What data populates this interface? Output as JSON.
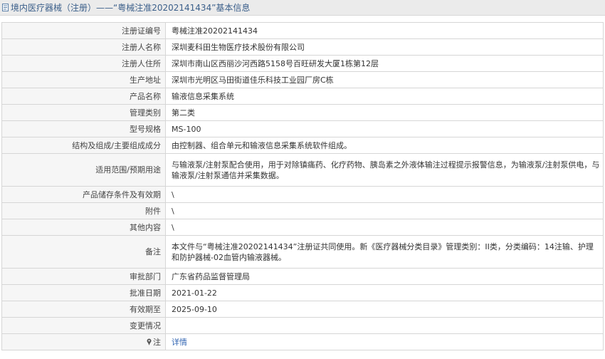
{
  "header": {
    "title": "境内医疗器械（注册）——“粤械注准20202141434”基本信息",
    "icon": "document-icon"
  },
  "rows": [
    {
      "label": "注册证编号",
      "value": "粤械注准20202141434"
    },
    {
      "label": "注册人名称",
      "value": "深圳麦科田生物医疗技术股份有限公司"
    },
    {
      "label": "注册人住所",
      "value": "深圳市南山区西丽沙河西路5158号百旺研发大厦1栋第12层"
    },
    {
      "label": "生产地址",
      "value": "深圳市光明区马田街道佳乐科技工业园厂房C栋"
    },
    {
      "label": "产品名称",
      "value": "输液信息采集系统"
    },
    {
      "label": "管理类别",
      "value": "第二类"
    },
    {
      "label": "型号规格",
      "value": "MS-100"
    },
    {
      "label": "结构及组成/主要组成成分",
      "value": "由控制器、组合单元和输液信息采集系统软件组成。"
    },
    {
      "label": "适用范围/预期用途",
      "value": "与输液泵/注射泵配合使用，用于对除镇痛药、化疗药物、胰岛素之外液体输注过程提示报警信息，为输液泵/注射泵供电，与输液泵/注射泵通信并采集数据。"
    },
    {
      "label": "产品储存条件及有效期",
      "value": "\\"
    },
    {
      "label": "附件",
      "value": "\\"
    },
    {
      "label": "其他内容",
      "value": "\\"
    },
    {
      "label": "备注",
      "value": "本文件与“粤械注准20202141434”注册证共同使用。新《医疗器械分类目录》管理类别：II类，分类编码：14注输、护理和防护器械-02血管内输液器械。"
    },
    {
      "label": "审批部门",
      "value": "广东省药品监督管理局"
    },
    {
      "label": "批准日期",
      "value": "2021-01-22"
    },
    {
      "label": "有效期至",
      "value": "2025-09-10"
    },
    {
      "label": "变更情况",
      "value": ""
    }
  ],
  "note_row": {
    "label": "注",
    "icon": "pin-icon",
    "link_text": "详情"
  },
  "colors": {
    "title_text": "#3b5f8a",
    "link": "#3467b3",
    "label_bg": "#f6f6f6",
    "border": "#d6d6d6"
  }
}
